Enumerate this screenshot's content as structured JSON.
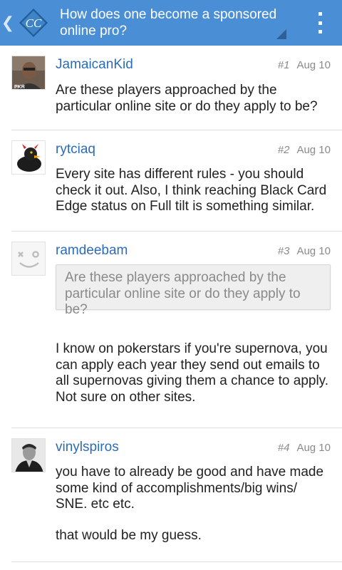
{
  "actionbar": {
    "title": "How does one become a sponsored online pro?",
    "logo_text": "CC",
    "up_icon": "chevron-left-icon",
    "menu_icon": "overflow-menu-icon"
  },
  "posts": [
    {
      "author": "JamaicanKid",
      "number": "#1",
      "date": "Aug 10",
      "avatar_label": "PKR",
      "body": "Are these players approached by the particular online site or do they apply to be?"
    },
    {
      "author": "rytciaq",
      "number": "#2",
      "date": "Aug 10",
      "body": "Every site has different rules - you should check it out. Also, I think reaching Black Card Edge status on Full tilt is something similar."
    },
    {
      "author": "ramdeebam",
      "number": "#3",
      "date": "Aug 10",
      "quote": "Are these players approached by the particular online site or do they apply to be?",
      "body": "I know on pokerstars if you're supernova, you can apply each year they send out emails to all supernovas giving them a chance to apply. Not sure on other sites."
    },
    {
      "author": "vinylspiros",
      "number": "#4",
      "date": "Aug 10",
      "body": "you have to already be good and have made some kind of accomplishments/big wins/ SNE. etc etc.",
      "body2": "that would be my guess."
    }
  ],
  "colors": {
    "actionbar": "#4a8fd6",
    "author_link": "#2b6cb8",
    "meta_text": "#8a8a8a"
  }
}
